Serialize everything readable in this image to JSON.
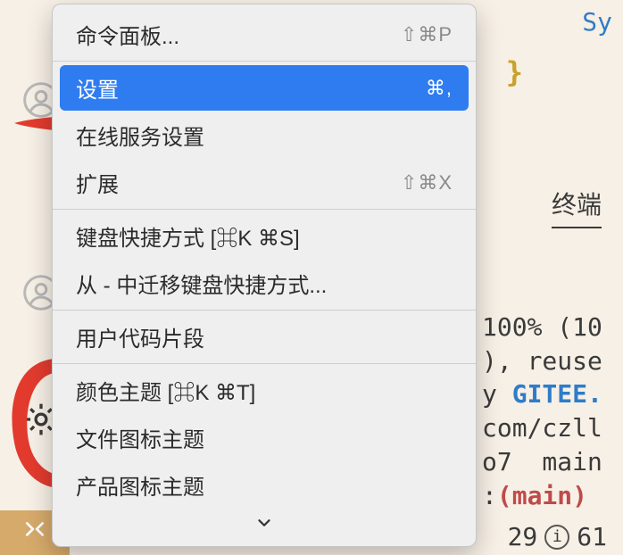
{
  "editor": {
    "sy_text": "Sy",
    "brace": "}"
  },
  "terminal": {
    "tab_label": "终端",
    "line1_a": "100% (10",
    "line2_a": "), reuse",
    "line3_a": "y ",
    "line3_kw": "GITEE.",
    "line4_a": "com/czll",
    "line5_a": "o7  main",
    "line6_a": ":",
    "line6_paren_open": "(",
    "line6_branch": "main",
    "line6_paren_close": ")"
  },
  "statusbar": {
    "n1": "29",
    "n2": "61"
  },
  "menu": {
    "items": [
      {
        "label": "命令面板...",
        "shortcut": "⇧⌘P",
        "selected": false
      },
      {
        "sep": true
      },
      {
        "label": "设置",
        "shortcut": "⌘,",
        "selected": true
      },
      {
        "label": "在线服务设置",
        "shortcut": "",
        "selected": false
      },
      {
        "label": "扩展",
        "shortcut": "⇧⌘X",
        "selected": false
      },
      {
        "sep": true
      },
      {
        "label": "键盘快捷方式 [⌘K ⌘S]",
        "shortcut": "",
        "selected": false
      },
      {
        "label": "从 - 中迁移键盘快捷方式...",
        "shortcut": "",
        "selected": false
      },
      {
        "sep": true
      },
      {
        "label": "用户代码片段",
        "shortcut": "",
        "selected": false
      },
      {
        "sep": true
      },
      {
        "label": "颜色主题 [⌘K ⌘T]",
        "shortcut": "",
        "selected": false
      },
      {
        "label": "文件图标主题",
        "shortcut": "",
        "selected": false
      },
      {
        "label": "产品图标主题",
        "shortcut": "",
        "selected": false
      }
    ]
  }
}
